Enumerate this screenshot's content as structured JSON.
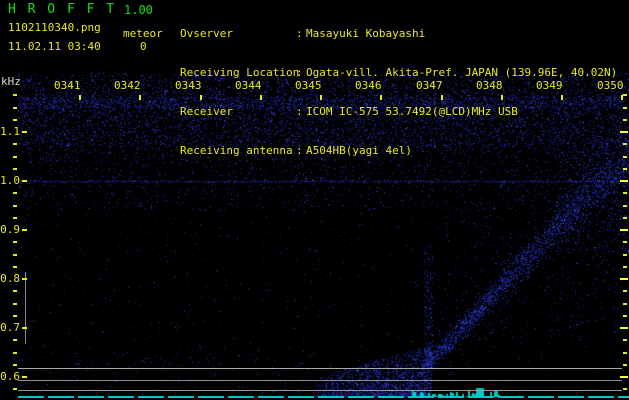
{
  "header": {
    "app_name": "H R O F F T",
    "version": "1.00",
    "filename": "1102110340.png",
    "mode_label": "meteor",
    "meteor_count": "0",
    "timestamp": "11.02.11 03:40",
    "info_rows": [
      {
        "label": "Ovserver",
        "sep": ":",
        "value": "Masayuki Kobayashi"
      },
      {
        "label": "Receiving Location",
        "sep": ":",
        "value": "Ogata-vill. Akita-Pref. JAPAN (139.96E, 40.02N)"
      },
      {
        "label": "Receiver",
        "sep": ":",
        "value": "ICOM IC-575 53.7492(@LCD)MHz USB"
      },
      {
        "label": "Receiving antenna",
        "sep": ":",
        "value": "A504HB(yagi 4el)"
      }
    ]
  },
  "spectrogram": {
    "y_axis_unit": "kHz",
    "time_labels": [
      "0341",
      "0342",
      "0343",
      "0344",
      "0345",
      "0346",
      "0347",
      "0348",
      "0349",
      "0350"
    ],
    "freq_labels": [
      "1.1",
      "1.0",
      "0.9",
      "0.8",
      "0.7",
      "0.6"
    ],
    "colors": {
      "text_green": "#15dd15",
      "text_yellow": "#e9e920",
      "text_white": "#d9d9d9",
      "noise_blue": "#2020c0",
      "carrier_gray": "#9a9a9a",
      "meter_cyan": "#00d2d2",
      "background": "#000000"
    }
  }
}
